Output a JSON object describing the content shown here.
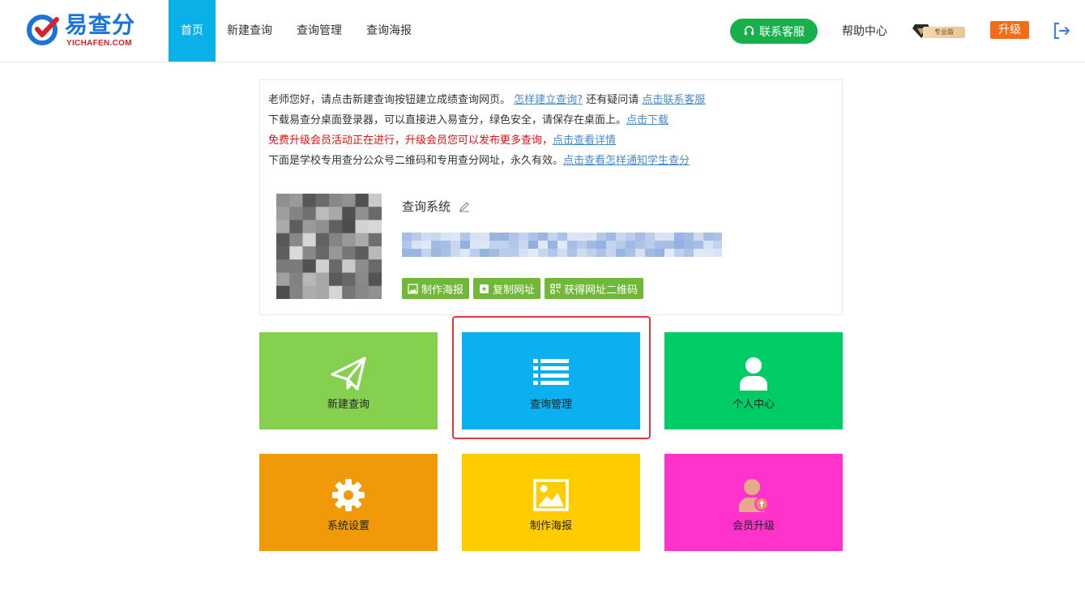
{
  "header": {
    "brand": "易查分",
    "domain": "YICHAFEN.COM",
    "nav": [
      {
        "label": "首页",
        "active": true
      },
      {
        "label": "新建查询",
        "active": false
      },
      {
        "label": "查询管理",
        "active": false
      },
      {
        "label": "查询海报",
        "active": false
      }
    ],
    "service_label": "联系客服",
    "help_label": "帮助中心",
    "vip_label": "专业版",
    "upgrade_label": "升级"
  },
  "notice": {
    "line1_text": "老师您好，请点击新建查询按钮建立成绩查询网页。",
    "line1_link": "怎样建立查询?",
    "line1_mid": "还有疑问请",
    "line1_link2": "点击联系客服",
    "line2_text": "下载易查分桌面登录器，可以直接进入易查分，绿色安全，请保存在桌面上。",
    "line2_link": "点击下载",
    "line3_text": "免费升级会员活动正在进行，升级会员您可以发布更多查询，",
    "line3_link": "点击查看详情",
    "line4_text": "下面是学校专用查分公众号二维码和专用查分网址，永久有效。",
    "line4_link": "点击查看怎样通知学生查分"
  },
  "site": {
    "title": "查询系统",
    "actions": [
      "制作海报",
      "复制网址",
      "获得网址二维码"
    ]
  },
  "tiles": [
    {
      "label": "新建查询",
      "icon": "paper-plane-icon",
      "color": "#86d04f"
    },
    {
      "label": "查询管理",
      "icon": "list-icon",
      "color": "#0ab0f0"
    },
    {
      "label": "个人中心",
      "icon": "user-icon",
      "color": "#00cc66"
    },
    {
      "label": "系统设置",
      "icon": "gear-icon",
      "color": "#f09a09"
    },
    {
      "label": "制作海报",
      "icon": "image-icon",
      "color": "#ffcc00"
    },
    {
      "label": "会员升级",
      "icon": "vip-user-icon",
      "color": "#ff33cc"
    }
  ],
  "colors": {
    "nav_active": "#0ab0e8",
    "service": "#18b04a",
    "upgrade": "#f36d19",
    "action_btn": "#71b83a",
    "highlight": "#e23a3a"
  }
}
